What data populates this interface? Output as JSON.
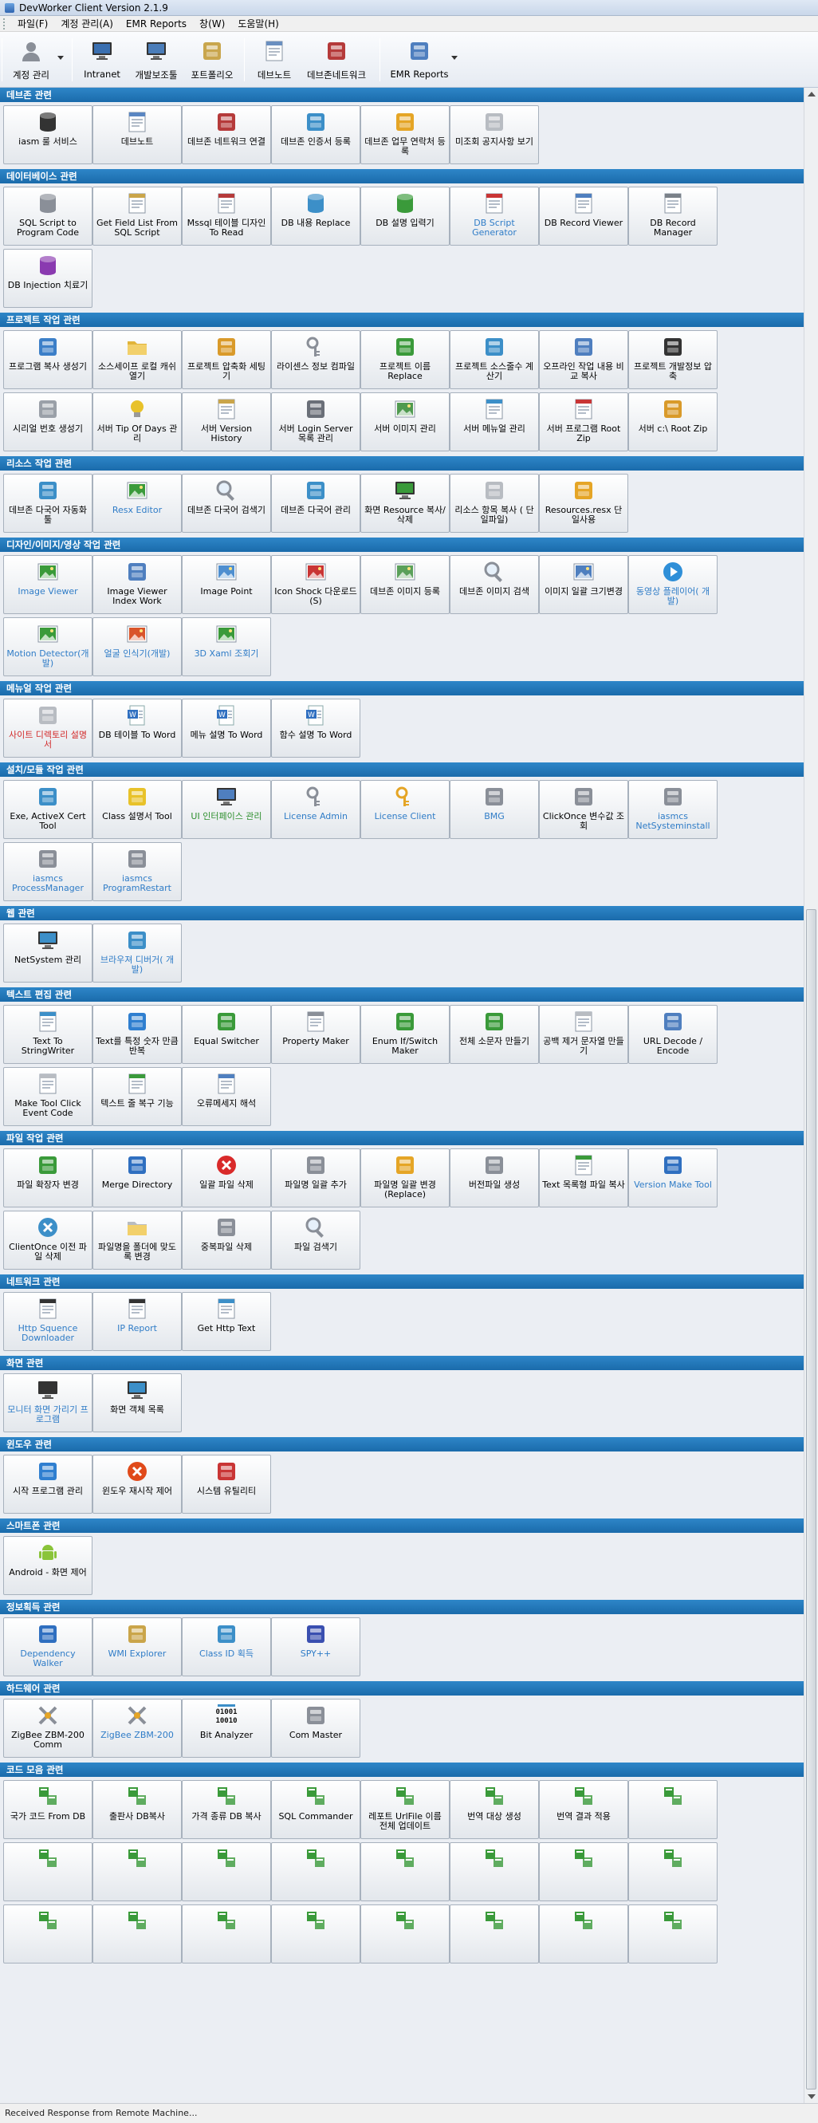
{
  "window": {
    "title": "DevWorker Client Version 2.1.9"
  },
  "menu": [
    {
      "label": "파일(F)"
    },
    {
      "label": "계정 관리(A)"
    },
    {
      "label": "EMR Reports"
    },
    {
      "label": "창(W)"
    },
    {
      "label": "도움말(H)"
    }
  ],
  "toolbar": [
    {
      "label": "계정 관리",
      "icon": "user-icon",
      "color": "#8a8f98"
    },
    {
      "label": "Intranet",
      "icon": "monitor-icon",
      "color": "#3a6fb0"
    },
    {
      "label": "개발보조툴",
      "icon": "computer-icon",
      "color": "#4b7db9"
    },
    {
      "label": "포트폴리오",
      "icon": "portfolio-icon",
      "color": "#c9a64d"
    },
    {
      "label": "데브노트",
      "icon": "note-icon",
      "color": "#6a8fc0"
    },
    {
      "label": "데브존네트워크",
      "icon": "network-icon",
      "color": "#b53a3a"
    },
    {
      "label": "EMR Reports",
      "icon": "report-icon",
      "color": "#4f7fbf"
    }
  ],
  "status": {
    "text": "Received Response from Remote Machine..."
  },
  "sections": [
    {
      "title": "데브존 관련",
      "items": [
        {
          "label": "iasm 룰 서비스",
          "icon": "server-icon",
          "color": "#333333"
        },
        {
          "label": "데브노트",
          "icon": "note-icon",
          "color": "#5a86c2"
        },
        {
          "label": "데브존 네트워크 연결",
          "icon": "network-icon",
          "color": "#b53a3a"
        },
        {
          "label": "데브존 인증서 등록",
          "icon": "certificate-icon",
          "color": "#3c8fc8"
        },
        {
          "label": "데브존 업무 연락처 등록",
          "icon": "contact-icon",
          "color": "#e5a526"
        },
        {
          "label": "미조회 공지사항 보기",
          "icon": "notice-icon",
          "color": "#b8bcc2"
        }
      ]
    },
    {
      "title": "데이터베이스 관련",
      "items": [
        {
          "label": "SQL Script to Program Code",
          "icon": "database-icon",
          "color": "#8a8f98"
        },
        {
          "label": "Get Field List From SQL Script",
          "icon": "field-list-icon",
          "color": "#caa54a"
        },
        {
          "label": "Mssql 테이블 디자인 To Read",
          "icon": "table-design-icon",
          "color": "#b53a3a"
        },
        {
          "label": "DB 내용 Replace",
          "icon": "db-replace-icon",
          "color": "#3c8fc8"
        },
        {
          "label": "DB 설명 입력기",
          "icon": "db-input-icon",
          "color": "#3a9a3a"
        },
        {
          "label": "DB Script Generator",
          "icon": "db-script-icon",
          "color": "#c93535",
          "style": "blue"
        },
        {
          "label": "DB Record Viewer",
          "icon": "record-viewer-icon",
          "color": "#4f7fbf"
        },
        {
          "label": "DB Record Manager",
          "icon": "record-manager-icon",
          "color": "#7a8088"
        },
        {
          "label": "DB Injection 치료기",
          "icon": "injection-icon",
          "color": "#8a3ab0"
        }
      ]
    },
    {
      "title": "프로젝트 작업 관련",
      "items": [
        {
          "label": "프로그램 복사 생성기",
          "icon": "copy-program-icon",
          "color": "#3c7fc8"
        },
        {
          "label": "소스세이프 로컬 캐쉬 열기",
          "icon": "folder-icon",
          "color": "#e1b43a"
        },
        {
          "label": "프로젝트 압축화 세팅기",
          "icon": "compress-icon",
          "color": "#d99a2a"
        },
        {
          "label": "라이센스 정보 컴파일",
          "icon": "key-icon",
          "color": "#8a8f98"
        },
        {
          "label": "프로젝트 이름 Replace",
          "icon": "rename-icon",
          "color": "#3a9a3a"
        },
        {
          "label": "프로젝트 소스줄수 계산기",
          "icon": "calculator-icon",
          "color": "#3c8fc8"
        },
        {
          "label": "오프라인 작업 내용 비교 복사",
          "icon": "compare-icon",
          "color": "#4f7fbf"
        },
        {
          "label": "프로젝트 개발정보 압축",
          "icon": "archive-icon",
          "color": "#333333"
        },
        {
          "label": "시리얼 번호 생성기",
          "icon": "serial-icon",
          "color": "#9aa0a8"
        },
        {
          "label": "서버 Tip Of Days 관리",
          "icon": "bulb-icon",
          "color": "#e8c22a"
        },
        {
          "label": "서버 Version History",
          "icon": "history-icon",
          "color": "#caa54a"
        },
        {
          "label": "서버 Login Server 목록 관리",
          "icon": "login-icon",
          "color": "#6a6f78"
        },
        {
          "label": "서버 이미지 관리",
          "icon": "image-icon",
          "color": "#4f9a4f"
        },
        {
          "label": "서버 메뉴얼 관리",
          "icon": "manual-icon",
          "color": "#3c8fc8"
        },
        {
          "label": "서버 프로그램 Root Zip",
          "icon": "books-icon",
          "color": "#c93535"
        },
        {
          "label": "서버 c:\\ Root Zip",
          "icon": "boxes-icon",
          "color": "#d99a2a"
        }
      ]
    },
    {
      "title": "리소스 작업 관련",
      "items": [
        {
          "label": "데브존 다국어 자동화툴",
          "icon": "language-icon",
          "color": "#3c8fc8"
        },
        {
          "label": "Resx Editor",
          "icon": "resx-icon",
          "color": "#3a9a3a",
          "style": "blue"
        },
        {
          "label": "데브존 다국어 검색기",
          "icon": "search-icon",
          "color": "#8a8f98"
        },
        {
          "label": "데브존 다국어 관리",
          "icon": "translate-icon",
          "color": "#3c8fc8"
        },
        {
          "label": "화면 Resource 복사/삭제",
          "icon": "screen-resource-icon",
          "color": "#3a9a3a"
        },
        {
          "label": "리소스 항목 복사 ( 단일파일)",
          "icon": "resource-copy-icon",
          "color": "#b8bcc2"
        },
        {
          "label": "Resources.resx 단일사용",
          "icon": "resources-icon",
          "color": "#e5a526"
        }
      ]
    },
    {
      "title": "디자인/이미지/영상 작업 관련",
      "items": [
        {
          "label": "Image Viewer",
          "icon": "image-viewer-icon",
          "color": "#3a9a3a",
          "style": "blue"
        },
        {
          "label": "Image Viewer Index Work",
          "icon": "index-work-icon",
          "color": "#4f7fbf"
        },
        {
          "label": "Image Point",
          "icon": "image-point-icon",
          "color": "#4f8fd0"
        },
        {
          "label": "Icon Shock 다운로드(S)",
          "icon": "iconshock-icon",
          "color": "#c93535"
        },
        {
          "label": "데브존 이미지 등록",
          "icon": "image-register-icon",
          "color": "#5aa05a"
        },
        {
          "label": "데브존 이미지 검색",
          "icon": "image-search-icon",
          "color": "#8a8f98"
        },
        {
          "label": "이미지 일괄 크기변경",
          "icon": "resize-icon",
          "color": "#4f7fbf"
        },
        {
          "label": "동영상 플레이어( 개발)",
          "icon": "play-icon",
          "color": "#2f8fd8",
          "style": "blue"
        },
        {
          "label": "Motion Detector(개발)",
          "icon": "motion-icon",
          "color": "#3a9a3a",
          "style": "blue"
        },
        {
          "label": "얼굴 인식기(개발)",
          "icon": "face-icon",
          "color": "#d9542a",
          "style": "blue"
        },
        {
          "label": "3D Xaml 조회기",
          "icon": "xaml-icon",
          "color": "#3a9a3a",
          "style": "blue"
        }
      ]
    },
    {
      "title": "메뉴얼 작업 관련",
      "items": [
        {
          "label": "사이트 디렉토리 설명서",
          "icon": "directory-icon",
          "color": "#b8bcc2",
          "style": "red"
        },
        {
          "label": "DB 테이블 To Word",
          "icon": "word-icon",
          "color": "#2f6fc0"
        },
        {
          "label": "메뉴 설명 To Word",
          "icon": "word-icon",
          "color": "#2f6fc0"
        },
        {
          "label": "함수 설명 To Word",
          "icon": "word-icon",
          "color": "#2f6fc0"
        }
      ]
    },
    {
      "title": "설치/모듈 작업 관련",
      "items": [
        {
          "label": "Exe, ActiveX Cert Tool",
          "icon": "cert-tool-icon",
          "color": "#3c8fc8"
        },
        {
          "label": "Class 설명서 Tool",
          "icon": "class-icon",
          "color": "#e8c22a"
        },
        {
          "label": "UI 인터페이스 관리",
          "icon": "ui-icon",
          "color": "#4f7fbf",
          "style": "green"
        },
        {
          "label": "License Admin",
          "icon": "key-icon",
          "color": "#8a8f98",
          "style": "blue"
        },
        {
          "label": "License Client",
          "icon": "gold-key-icon",
          "color": "#e5a526",
          "style": "blue"
        },
        {
          "label": "BMG",
          "icon": "module-icon",
          "color": "#8a8f98",
          "style": "blue"
        },
        {
          "label": "ClickOnce 변수값 조회",
          "icon": "module-icon",
          "color": "#8a8f98"
        },
        {
          "label": "iasmcs NetSysteminstall",
          "icon": "module-icon",
          "color": "#8a8f98",
          "style": "blue"
        },
        {
          "label": "iasmcs ProcessManager",
          "icon": "module-icon",
          "color": "#8a8f98",
          "style": "blue"
        },
        {
          "label": "iasmcs ProgramRestart",
          "icon": "module-icon",
          "color": "#8a8f98",
          "style": "blue"
        }
      ]
    },
    {
      "title": "웹 관련",
      "items": [
        {
          "label": "NetSystem 관리",
          "icon": "netsystem-icon",
          "color": "#3c8fc8"
        },
        {
          "label": "브라우져 디버거( 개발)",
          "icon": "browser-icon",
          "color": "#3c8fc8",
          "style": "blue"
        }
      ]
    },
    {
      "title": "텍스트 편집 관련",
      "items": [
        {
          "label": "Text To StringWriter",
          "icon": "text-icon",
          "color": "#3c8fc8"
        },
        {
          "label": "Text를 특정 숫자 만큼 반복",
          "icon": "repeat-icon",
          "color": "#2f7fd0"
        },
        {
          "label": "Equal Switcher",
          "icon": "switch-icon",
          "color": "#3a9a3a"
        },
        {
          "label": "Property Maker",
          "icon": "property-icon",
          "color": "#8a8f98"
        },
        {
          "label": "Enum If/Switch Maker",
          "icon": "enum-icon",
          "color": "#3a9a3a"
        },
        {
          "label": "전체 소문자 만들기",
          "icon": "lowercase-icon",
          "color": "#3a9a3a"
        },
        {
          "label": "공백 제거 문자열 만들기",
          "icon": "trim-icon",
          "color": "#b8bcc2"
        },
        {
          "label": "URL Decode / Encode",
          "icon": "url-icon",
          "color": "#4f7fbf"
        },
        {
          "label": "Make Tool Click Event Code",
          "icon": "event-icon",
          "color": "#b8bcc2"
        },
        {
          "label": "텍스트 줄 복구 기능",
          "icon": "line-icon",
          "color": "#3a9a3a"
        },
        {
          "label": "오류메세지 해석",
          "icon": "error-message-icon",
          "color": "#4f7fbf"
        }
      ]
    },
    {
      "title": "파일 작업 관련",
      "items": [
        {
          "label": "파일 확장자 변경",
          "icon": "refresh-icon",
          "color": "#3a9a3a"
        },
        {
          "label": "Merge Directory",
          "icon": "merge-icon",
          "color": "#2f6fc0"
        },
        {
          "label": "일괄 파일 삭제",
          "icon": "delete-icon",
          "color": "#d92a2a"
        },
        {
          "label": "파일명 일괄 추가",
          "icon": "file-add-icon",
          "color": "#8a8f98"
        },
        {
          "label": "파일명 일괄 변경 (Replace)",
          "icon": "file-replace-icon",
          "color": "#e5a526"
        },
        {
          "label": "버전파일 생성",
          "icon": "version-file-icon",
          "color": "#8a8f98"
        },
        {
          "label": "Text 목록형 파일 복사",
          "icon": "list-copy-icon",
          "color": "#3a9a3a"
        },
        {
          "label": "Version Make Tool",
          "icon": "floppy-icon",
          "color": "#2f6fc0",
          "style": "blue"
        },
        {
          "label": "ClientOnce 이전 파일 삭제",
          "icon": "client-delete-icon",
          "color": "#3c8fc8"
        },
        {
          "label": "파일명을 폴더에 맞도록 변경",
          "icon": "folder-rename-icon",
          "color": "#b8bcc2"
        },
        {
          "label": "중복파일 삭제",
          "icon": "duplicate-icon",
          "color": "#8a8f98"
        },
        {
          "label": "파일 검색기",
          "icon": "file-search-icon",
          "color": "#8a8f98"
        }
      ]
    },
    {
      "title": "네트워크 관련",
      "items": [
        {
          "label": "Http Squence Downloader",
          "icon": "downloader-icon",
          "color": "#333333",
          "style": "blue"
        },
        {
          "label": "IP Report",
          "icon": "ip-icon",
          "color": "#333333",
          "style": "blue"
        },
        {
          "label": "Get Http Text",
          "icon": "http-icon",
          "color": "#3c8fc8"
        }
      ]
    },
    {
      "title": "화면 관련",
      "items": [
        {
          "label": "모니터 화면 가리기 프로그램",
          "icon": "monitor-cover-icon",
          "color": "#333333",
          "style": "blue"
        },
        {
          "label": "화면 객체 목록",
          "icon": "screen-list-icon",
          "color": "#3c8fc8"
        }
      ]
    },
    {
      "title": "윈도우 관련",
      "items": [
        {
          "label": "시작 프로그램 관리",
          "icon": "startup-icon",
          "color": "#2f7fd0"
        },
        {
          "label": "윈도우 재시작 제어",
          "icon": "restart-icon",
          "color": "#e04a1a"
        },
        {
          "label": "시스템 유틸리티",
          "icon": "utility-icon",
          "color": "#c93535"
        }
      ]
    },
    {
      "title": "스마트폰 관련",
      "items": [
        {
          "label": "Android - 화면 제어",
          "icon": "android-icon",
          "color": "#8ac43a"
        }
      ]
    },
    {
      "title": "정보획득 관련",
      "items": [
        {
          "label": "Dependency Walker",
          "icon": "dependency-icon",
          "color": "#2f6fc0",
          "style": "blue"
        },
        {
          "label": "WMI Explorer",
          "icon": "wmi-icon",
          "color": "#caa54a",
          "style": "blue"
        },
        {
          "label": "Class ID 획득",
          "icon": "classid-icon",
          "color": "#3c8fc8",
          "style": "blue"
        },
        {
          "label": "SPY++",
          "icon": "spy-icon",
          "color": "#3a4fb0",
          "style": "blue"
        }
      ]
    },
    {
      "title": "하드웨어 관련",
      "items": [
        {
          "label": "ZigBee ZBM-200 Comm",
          "icon": "zigbee-icon",
          "color": "#8a8f98"
        },
        {
          "label": "ZigBee ZBM-200",
          "icon": "zigbee-icon",
          "color": "#8a8f98",
          "style": "blue"
        },
        {
          "label": "Bit Analyzer",
          "icon": "binary-icon",
          "color": "#111111"
        },
        {
          "label": "Com Master",
          "icon": "com-icon",
          "color": "#8a8f98"
        }
      ]
    },
    {
      "title": "코드 모음 관련",
      "items": [
        {
          "label": "국가 코드 From DB",
          "icon": "code-icon",
          "color": "#3a9a3a"
        },
        {
          "label": "출판사 DB복사",
          "icon": "code-icon",
          "color": "#3a9a3a"
        },
        {
          "label": "가격 종류 DB 복사",
          "icon": "code-icon",
          "color": "#3a9a3a"
        },
        {
          "label": "SQL Commander",
          "icon": "code-icon",
          "color": "#3a9a3a"
        },
        {
          "label": "레포트 UrlFile 이름 전체 업데이트",
          "icon": "code-icon",
          "color": "#3a9a3a"
        },
        {
          "label": "번역 대상 생성",
          "icon": "code-icon",
          "color": "#3a9a3a"
        },
        {
          "label": "번역 결과 적용",
          "icon": "code-icon",
          "color": "#3a9a3a"
        },
        {
          "label": "",
          "icon": "code-icon",
          "color": "#3a9a3a"
        },
        {
          "label": "",
          "icon": "code-icon",
          "color": "#3a9a3a"
        },
        {
          "label": "",
          "icon": "code-icon",
          "color": "#3a9a3a"
        },
        {
          "label": "",
          "icon": "code-icon",
          "color": "#3a9a3a"
        },
        {
          "label": "",
          "icon": "code-icon",
          "color": "#3a9a3a"
        },
        {
          "label": "",
          "icon": "code-icon",
          "color": "#3a9a3a"
        },
        {
          "label": "",
          "icon": "code-icon",
          "color": "#3a9a3a"
        },
        {
          "label": "",
          "icon": "code-icon",
          "color": "#3a9a3a"
        },
        {
          "label": "",
          "icon": "code-icon",
          "color": "#3a9a3a"
        },
        {
          "label": "",
          "icon": "code-icon",
          "color": "#3a9a3a"
        },
        {
          "label": "",
          "icon": "code-icon",
          "color": "#3a9a3a"
        },
        {
          "label": "",
          "icon": "code-icon",
          "color": "#3a9a3a"
        },
        {
          "label": "",
          "icon": "code-icon",
          "color": "#3a9a3a"
        },
        {
          "label": "",
          "icon": "code-icon",
          "color": "#3a9a3a"
        },
        {
          "label": "",
          "icon": "code-icon",
          "color": "#3a9a3a"
        },
        {
          "label": "",
          "icon": "code-icon",
          "color": "#3a9a3a"
        },
        {
          "label": "",
          "icon": "code-icon",
          "color": "#3a9a3a"
        }
      ]
    }
  ]
}
